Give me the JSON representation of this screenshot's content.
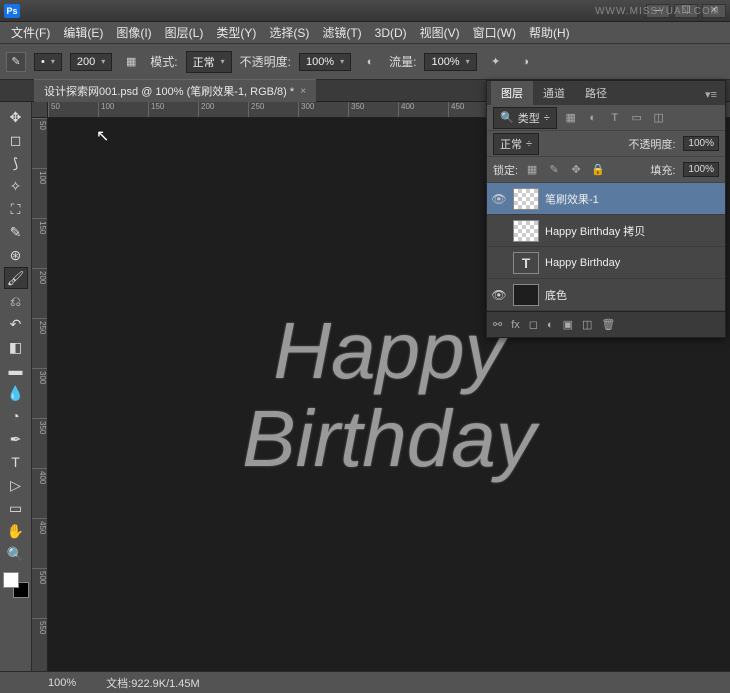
{
  "app": {
    "ps_label": "Ps"
  },
  "menu": {
    "file": "文件(F)",
    "edit": "编辑(E)",
    "image": "图像(I)",
    "layer": "图层(L)",
    "type": "类型(Y)",
    "select": "选择(S)",
    "filter": "滤镜(T)",
    "threed": "3D(D)",
    "view": "视图(V)",
    "window": "窗口(W)",
    "help": "帮助(H)"
  },
  "options": {
    "brush_size": "200",
    "mode_label": "模式:",
    "mode_value": "正常",
    "opacity_label": "不透明度:",
    "opacity_value": "100%",
    "flow_label": "流量:",
    "flow_value": "100%"
  },
  "document": {
    "tab_title": "设计探索网001.psd @ 100% (笔刷效果-1, RGB/8) *",
    "canvas_line1": "Happy",
    "canvas_line2": "Birthday"
  },
  "ruler_h": [
    "50",
    "100",
    "150",
    "200",
    "250",
    "300",
    "350",
    "400",
    "450"
  ],
  "ruler_v": [
    "50",
    "100",
    "150",
    "200",
    "250",
    "300",
    "350",
    "400",
    "450",
    "500",
    "550"
  ],
  "panel": {
    "tabs": {
      "layers": "图层",
      "channels": "通道",
      "paths": "路径"
    },
    "filter_label": "类型",
    "blend_mode": "正常",
    "opacity_label": "不透明度:",
    "opacity_value": "100%",
    "lock_label": "锁定:",
    "fill_label": "填充:",
    "fill_value": "100%",
    "layers": [
      {
        "name": "笔刷效果-1",
        "visible": true,
        "type": "raster",
        "selected": true
      },
      {
        "name": "Happy  Birthday 拷贝",
        "visible": false,
        "type": "raster",
        "selected": false
      },
      {
        "name": "Happy  Birthday",
        "visible": false,
        "type": "text",
        "selected": false
      },
      {
        "name": "底色",
        "visible": true,
        "type": "solid",
        "selected": false
      }
    ],
    "footer_fx": "fx"
  },
  "status": {
    "zoom": "100%",
    "docinfo_label": "文档:",
    "docinfo_value": "922.9K/1.45M"
  },
  "watermark": "WWW.MISSYUAN.COM"
}
